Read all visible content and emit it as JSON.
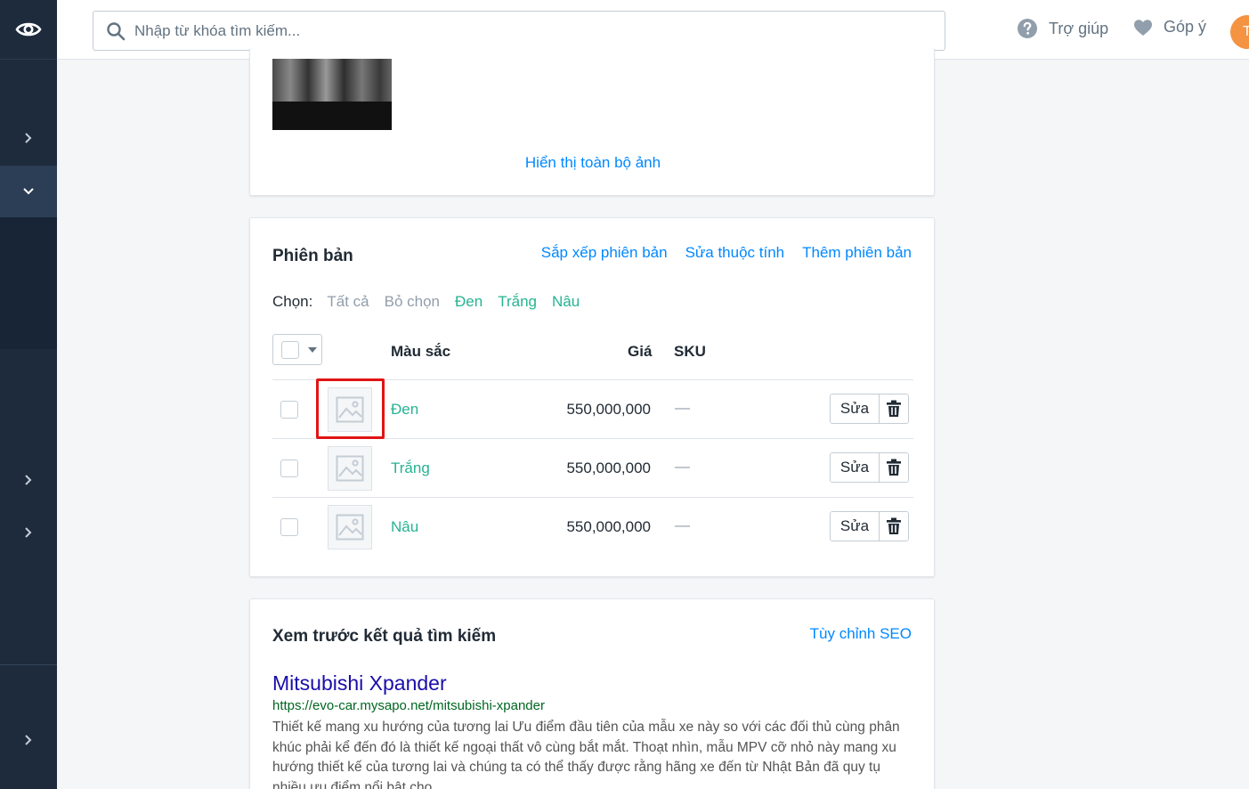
{
  "topbar": {
    "search_placeholder": "Nhập từ khóa tìm kiếm...",
    "help_label": "Trợ giúp",
    "feedback_label": "Góp ý",
    "avatar_initial": "T"
  },
  "images_card": {
    "show_all_label": "Hiển thị toàn bộ ảnh"
  },
  "variants": {
    "title": "Phiên bản",
    "actions": [
      "Sắp xếp phiên bản",
      "Sửa thuộc tính",
      "Thêm phiên bản"
    ],
    "filter_label": "Chọn:",
    "filters": [
      "Tất cả",
      "Bỏ chọn",
      "Đen",
      "Trắng",
      "Nâu"
    ],
    "columns": {
      "color": "Màu sắc",
      "price": "Giá",
      "sku": "SKU"
    },
    "rows": [
      {
        "color": "Đen",
        "price": "550,000,000",
        "sku": "—",
        "edit_label": "Sửa"
      },
      {
        "color": "Trắng",
        "price": "550,000,000",
        "sku": "—",
        "edit_label": "Sửa"
      },
      {
        "color": "Nâu",
        "price": "550,000,000",
        "sku": "—",
        "edit_label": "Sửa"
      }
    ]
  },
  "seo": {
    "title": "Xem trước kết quả tìm kiếm",
    "customize_label": "Tùy chỉnh SEO",
    "preview_title": "Mitsubishi Xpander",
    "preview_url": "https://evo-car.mysapo.net/mitsubishi-xpander",
    "preview_desc": "Thiết kế mang xu hướng của tương lai Ưu điểm đầu tiên của mẫu xe này so với các đối thủ cùng phân khúc phải kể đến đó là thiết kế ngoại thất vô cùng bắt mắt. Thoạt nhìn, mẫu MPV cỡ nhỏ này mang xu hướng thiết kế của tương lai và chúng ta có thể thấy được rằng hãng xe đến từ Nhật Bản đã quy tụ nhiều ưu điểm nổi bật cho"
  },
  "colors": {
    "link": "#0088ff",
    "variant_green": "#26b392",
    "sidebar": "#1d2b3d",
    "highlight": "#e11414",
    "avatar": "#f49342"
  },
  "icons": [
    "eye-icon",
    "search-icon",
    "help-icon",
    "heart-icon",
    "chevron-right-icon",
    "chevron-down-icon",
    "image-placeholder-icon",
    "trash-icon",
    "caret-down-icon"
  ]
}
